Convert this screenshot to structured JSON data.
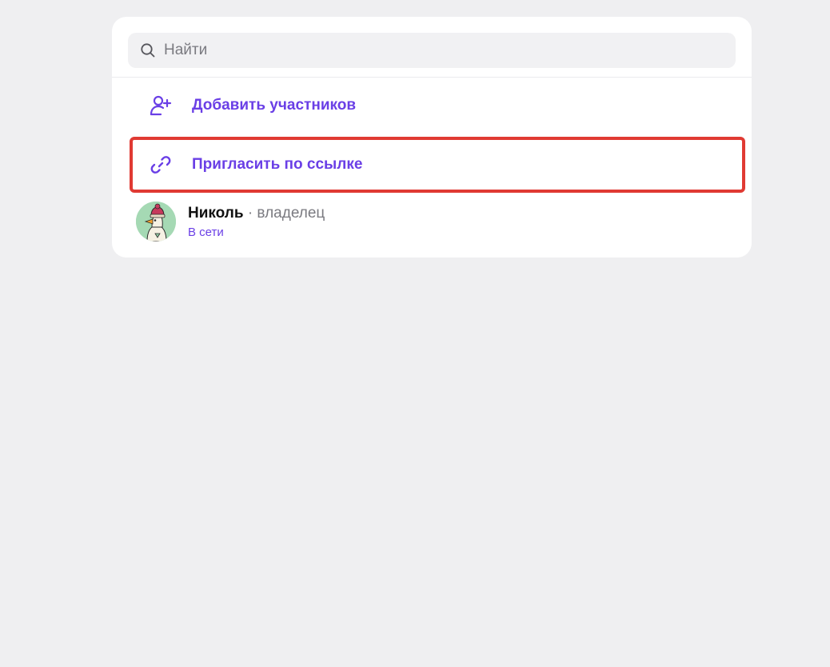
{
  "search": {
    "placeholder": "Найти",
    "icon": "search-icon"
  },
  "actions": [
    {
      "label": "Добавить участников",
      "icon": "add-user-icon"
    },
    {
      "label": "Пригласить по ссылке",
      "icon": "link-icon"
    }
  ],
  "members": [
    {
      "name": "Николь",
      "role": " · владелец",
      "status": "В сети"
    }
  ],
  "colors": {
    "accent": "#6a3fe6",
    "highlight": "#e03a33",
    "background": "#efeff1"
  }
}
